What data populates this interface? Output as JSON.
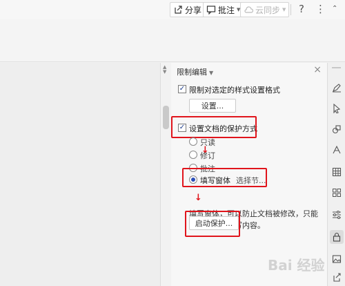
{
  "toolbar": {
    "share_label": "分享",
    "comment_label": "批注",
    "sync_label": "云同步",
    "help_label": "?",
    "more_label": "⋮"
  },
  "scrollbar": {
    "up": "▲",
    "down": "▼"
  },
  "panel": {
    "title": "限制编辑",
    "close_label": "×",
    "format_restriction": {
      "checked": true,
      "label": "限制对选定的样式设置格式"
    },
    "settings_button": "设置...",
    "protection": {
      "checked": true,
      "label": "设置文档的保护方式"
    },
    "modes": [
      {
        "label": "只读",
        "selected": false
      },
      {
        "label": "修订",
        "selected": false
      },
      {
        "label": "批注",
        "selected": false
      },
      {
        "label": "填写窗体",
        "selected": true
      }
    ],
    "select_section_link": "选择节...",
    "description": "填写窗体，可以防止文档被修改，只能在窗体域中填写内容。",
    "start_protection_button": "启动保护..."
  },
  "right_tools": [
    "pen-icon",
    "cursor-icon",
    "shapes-icon",
    "style-icon",
    "table-icon",
    "apps-icon",
    "settings-sliders-icon",
    "lock-icon",
    "image-icon",
    "share-out-icon"
  ],
  "watermark": "Bai 经验",
  "colors": {
    "highlight": "#e0141b",
    "accent": "#2a4fb8"
  }
}
